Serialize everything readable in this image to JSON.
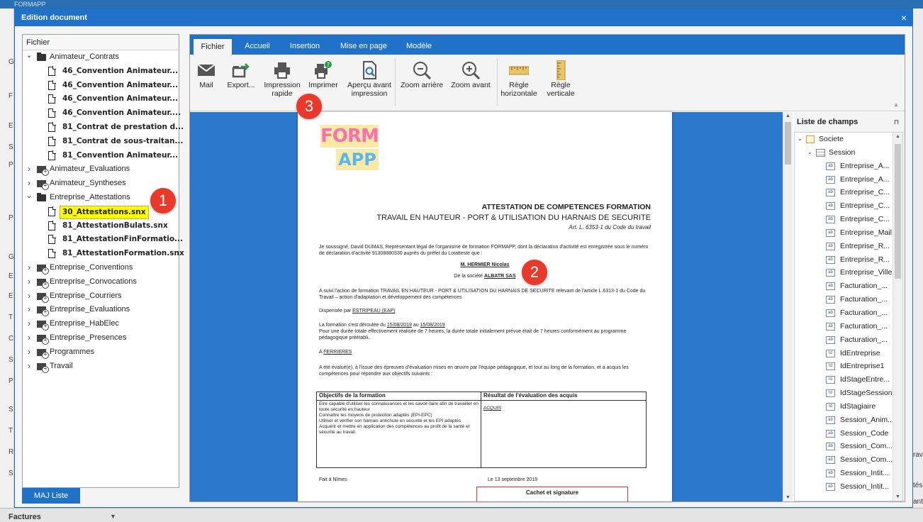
{
  "app": {
    "title": "FORMAPP"
  },
  "background": {
    "left_letters": [
      "G",
      "F",
      "E",
      "S",
      "P",
      "P",
      "G",
      "E",
      "E",
      "T",
      "C",
      "S",
      "P",
      "S",
      "T",
      "R",
      "S"
    ],
    "right_texts": [
      "rav",
      "tés",
      "ant"
    ],
    "bottom_label": "Factures"
  },
  "dialog": {
    "title": "Edition document",
    "close": "×",
    "refresh_button": "MAJ Liste"
  },
  "tree": {
    "header": "Fichier",
    "nodes": [
      {
        "label": "Animateur_Contrats",
        "type": "folder",
        "expanded": true
      },
      {
        "label": "46_Convention Animateur...",
        "type": "file"
      },
      {
        "label": "46_Convention Animateur...",
        "type": "file"
      },
      {
        "label": "46_Convention Animateur...",
        "type": "file"
      },
      {
        "label": "46_Convention Animateur....",
        "type": "file"
      },
      {
        "label": "81_Contrat de prestation d...",
        "type": "file"
      },
      {
        "label": "81_Contrat de sous-traitan...",
        "type": "file"
      },
      {
        "label": "81_Convention Animateur...",
        "type": "file"
      },
      {
        "label": "Animateur_Evaluations",
        "type": "folder",
        "expanded": false
      },
      {
        "label": "Animateur_Syntheses",
        "type": "folder",
        "expanded": false
      },
      {
        "label": "Entreprise_Attestations",
        "type": "folder",
        "expanded": true
      },
      {
        "label": "30_Attestations.snx",
        "type": "file",
        "selected": true
      },
      {
        "label": "81_AttestationBulats.snx",
        "type": "file"
      },
      {
        "label": "81_AttestationFinFormatio...",
        "type": "file"
      },
      {
        "label": "81_AttestationFormation.snx",
        "type": "file"
      },
      {
        "label": "Entreprise_Conventions",
        "type": "folder",
        "expanded": false
      },
      {
        "label": "Entreprise_Convocations",
        "type": "folder",
        "expanded": false
      },
      {
        "label": "Entreprise_Courriers",
        "type": "folder",
        "expanded": false
      },
      {
        "label": "Entreprise_Evaluations",
        "type": "folder",
        "expanded": false
      },
      {
        "label": "Entreprise_HabElec",
        "type": "folder",
        "expanded": false
      },
      {
        "label": "Entreprise_Presences",
        "type": "folder",
        "expanded": false
      },
      {
        "label": "Programmes",
        "type": "folder",
        "expanded": false
      },
      {
        "label": "Travail",
        "type": "folder",
        "expanded": false
      }
    ]
  },
  "ribbon": {
    "tabs": [
      "Fichier",
      "Accueil",
      "Insertion",
      "Mise en page",
      "Modèle"
    ],
    "active_tab": 0,
    "buttons": [
      {
        "label": "Mail",
        "icon": "mail-icon"
      },
      {
        "label": "Export...",
        "icon": "export-icon"
      },
      {
        "label": "Impression\nrapide",
        "icon": "quick-print-icon"
      },
      {
        "label": "Imprimer",
        "icon": "print-icon"
      },
      {
        "label": "Aperçu avant\nimpression",
        "icon": "print-preview-icon"
      },
      {
        "label": "Zoom arrière",
        "icon": "zoom-out-icon"
      },
      {
        "label": "Zoom avant",
        "icon": "zoom-in-icon"
      },
      {
        "label": "Règle\nhorizontale",
        "icon": "horizontal-ruler-icon"
      },
      {
        "label": "Règle\nverticale",
        "icon": "vertical-ruler-icon"
      }
    ]
  },
  "document": {
    "logo_line1": "FORM",
    "logo_line2": "APP",
    "title": "ATTESTATION DE COMPETENCES FORMATION",
    "subtitle": "TRAVAIL EN HAUTEUR - PORT & UTILISATION DU HARNAIS DE SECURITE",
    "reference": "Art. L. 6353-1 du Code du travail",
    "intro": "Je soussigné, David DUMAS, Représentant légal de l'organisme de formation FORMAPP, dont la déclaration d'activité est enregistrée sous le numéro de déclaration d'activité 91308880330 auprès du préfet du Lotatteste que :",
    "trainee": "M. HERMIER Nicolas",
    "company_prefix": "De la société ",
    "company": "ALBATR SAS",
    "followed": "A suivi l'action de formation TRAVAIL EN HAUTEUR - PORT & UTILISATION DU HARNAIS DE SECURITE relevant de l'article L.6313-1 du Code du Travail – action d'adaptation et développement des compétences",
    "provider_prefix": "Dispensée par ",
    "provider": "ESTRIPEAU (EAP)",
    "dates_prefix": "La formation s'est déroulée du ",
    "date_start": "15/08/2019",
    "dates_mid": " au ",
    "date_end": "15/08/2019",
    "duration": "Pour une durée totale effectivement réalisée de 7 heures, la durée totale initialement prévue était de 7 heures conformément au programme pédagogique préétabli.",
    "place_prefix": "A ",
    "place": "FERRIERES",
    "evaluation": "A été évalué(e), à l'issue des épreuves d'évaluation mises en œuvre par l'équipe pédagogique, et tout au long de la formation, et a acquis les compétences pour répondre aux objectifs suivants :",
    "table_head_objectives": "Objectifs de la formation",
    "table_head_results": "Résultat de l'évaluation des acquis",
    "objectives": [
      "Etre capable d'utiliser les connaissances et les savoir-faire afin de travailler en toute sécurité en hauteur",
      "Connaître les moyens de protection adaptés (EPI-EPC)",
      "Utiliser et vérifier son harnais antichute en sécurité et les EPI adaptés",
      "Acquérir et mettre en application des compétences au profit de la santé et sécurité au travail"
    ],
    "result": "ACQUIS",
    "done_at": "Fait à Nîmes",
    "date_signed": "Le 13 septembre 2019",
    "stamp": "Cachet et signature"
  },
  "fields": {
    "header": "Liste de champs",
    "pin": "⊓",
    "items": [
      {
        "label": "Societe",
        "kind": "root",
        "level": 0
      },
      {
        "label": "Session",
        "kind": "table",
        "level": 1
      },
      {
        "label": "Entreprise_A...",
        "kind": "ab",
        "level": 2
      },
      {
        "label": "Entreprise_A...",
        "kind": "ab",
        "level": 2
      },
      {
        "label": "Entreprise_C...",
        "kind": "ab",
        "level": 2
      },
      {
        "label": "Entreprise_C...",
        "kind": "ab",
        "level": 2
      },
      {
        "label": "Entreprise_C...",
        "kind": "ab",
        "level": 2
      },
      {
        "label": "Entreprise_Mail",
        "kind": "ab",
        "level": 2
      },
      {
        "label": "Entreprise_R...",
        "kind": "ab",
        "level": 2
      },
      {
        "label": "Entreprise_R...",
        "kind": "ab",
        "level": 2
      },
      {
        "label": "Entreprise_Ville",
        "kind": "ab",
        "level": 2
      },
      {
        "label": "Facturation_...",
        "kind": "ab",
        "level": 2
      },
      {
        "label": "Facturation_...",
        "kind": "ab",
        "level": 2
      },
      {
        "label": "Facturation_...",
        "kind": "ab",
        "level": 2
      },
      {
        "label": "Facturation_...",
        "kind": "ab",
        "level": 2
      },
      {
        "label": "Facturation_...",
        "kind": "ab",
        "level": 2
      },
      {
        "label": "IdEntreprise",
        "kind": "id",
        "level": 2
      },
      {
        "label": "IdEntreprise1",
        "kind": "id",
        "level": 2
      },
      {
        "label": "IdStageEntre...",
        "kind": "id",
        "level": 2
      },
      {
        "label": "IdStageSession",
        "kind": "id",
        "level": 2
      },
      {
        "label": "IdStagiaire",
        "kind": "id",
        "level": 2
      },
      {
        "label": "Session_Anim...",
        "kind": "ab",
        "level": 2
      },
      {
        "label": "Session_Code",
        "kind": "ab",
        "level": 2
      },
      {
        "label": "Session_Com...",
        "kind": "ab",
        "level": 2
      },
      {
        "label": "Session_Com...",
        "kind": "ab",
        "level": 2
      },
      {
        "label": "Session_Intit...",
        "kind": "ab",
        "level": 2
      },
      {
        "label": "Session_Intit...",
        "kind": "ab",
        "level": 2
      }
    ]
  },
  "annotations": [
    "1",
    "2",
    "3"
  ]
}
